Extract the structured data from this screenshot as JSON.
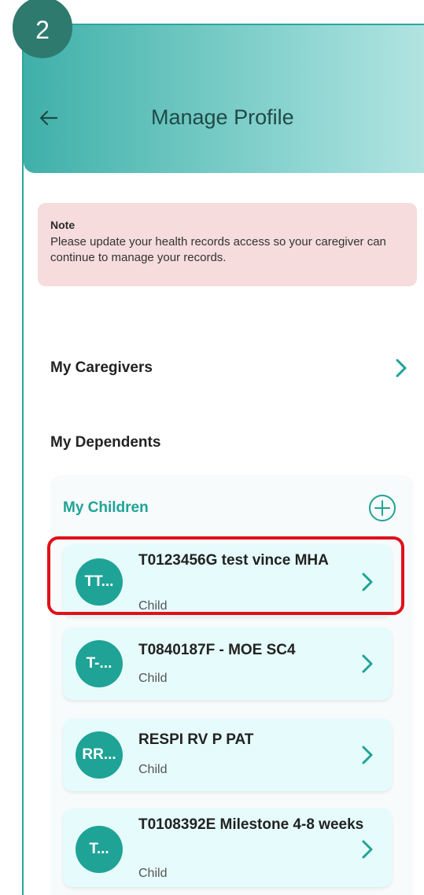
{
  "step_badge": "2",
  "header": {
    "title": "Manage Profile"
  },
  "note": {
    "title": "Note",
    "text": "Please update your health records access so your caregiver can continue to manage your records."
  },
  "caregivers": {
    "label": "My Caregivers"
  },
  "dependents": {
    "label": "My Dependents"
  },
  "children": {
    "title": "My Children",
    "items": [
      {
        "initials": "TT...",
        "name": "T0123456G test vince MHA",
        "role": "Child"
      },
      {
        "initials": "T-...",
        "name": "T0840187F - MOE SC4",
        "role": "Child"
      },
      {
        "initials": "RR...",
        "name": "RESPI RV P PAT",
        "role": "Child"
      },
      {
        "initials": "T...",
        "name": "T0108392E Milestone 4-8 weeks",
        "role": "Child"
      }
    ]
  },
  "colors": {
    "accent": "#1fa396",
    "highlight": "#e0101a",
    "note_bg": "#f6dcdc"
  }
}
